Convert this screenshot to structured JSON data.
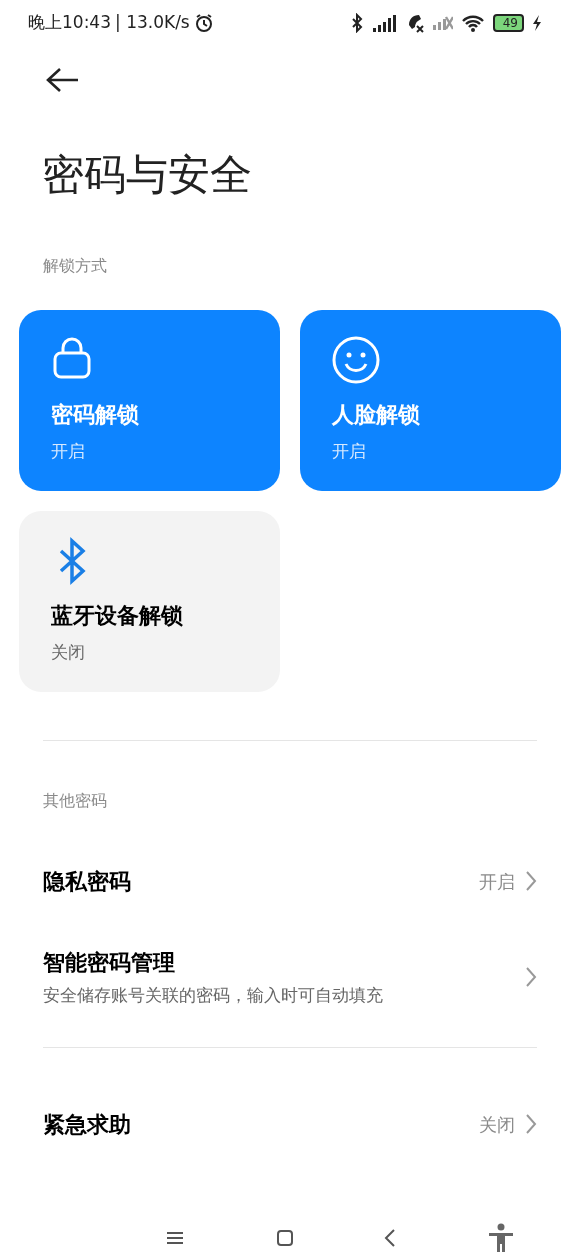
{
  "status_bar": {
    "time": "晚上10:43",
    "speed": "| 13.0K/s",
    "battery": "49"
  },
  "title": "密码与安全",
  "unlock_section": {
    "label": "解锁方式",
    "methods": [
      {
        "kind": "lock",
        "title": "密码解锁",
        "status": "开启",
        "on": true
      },
      {
        "kind": "face",
        "title": "人脸解锁",
        "status": "开启",
        "on": true
      },
      {
        "kind": "bluetooth",
        "title": "蓝牙设备解锁",
        "status": "关闭",
        "on": false
      }
    ]
  },
  "other_section": {
    "label": "其他密码",
    "rows": [
      {
        "title": "隐私密码",
        "value": "开启"
      },
      {
        "title": "智能密码管理",
        "subtitle": "安全储存账号关联的密码，输入时可自动填充"
      }
    ]
  },
  "extra_rows": [
    {
      "title": "紧急求助",
      "value": "关闭"
    }
  ]
}
